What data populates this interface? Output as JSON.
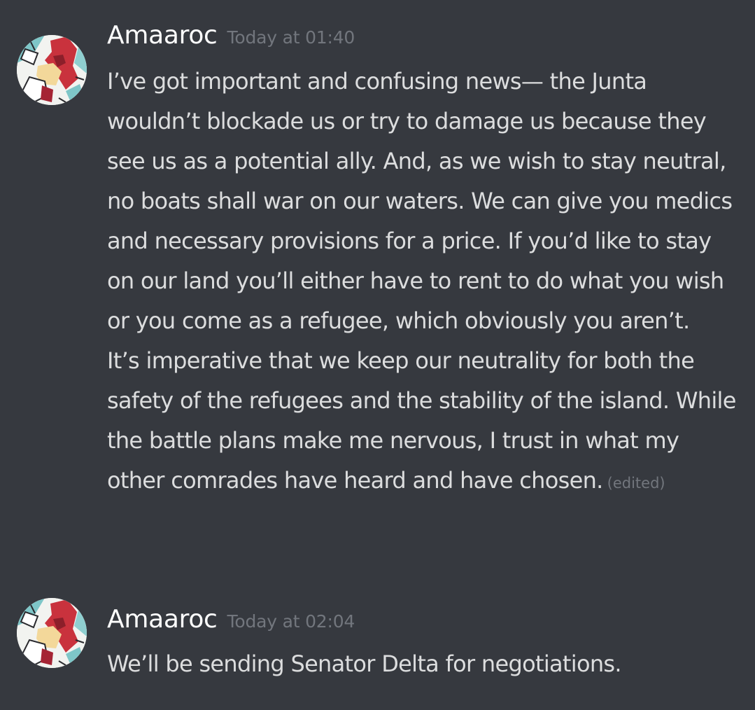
{
  "messages": [
    {
      "author": "Amaaroc",
      "timestamp": "Today at 01:40",
      "avatar_icon": "user-avatar-red-white-character",
      "paragraphs": [
        "I’ve got important and confusing news— the Junta wouldn’t blockade us or try to damage us because they see us as a potential ally. And, as we wish to stay neutral, no boats shall war on our waters. We can give you medics and necessary provisions for a price. If you’d like to stay on our land you’ll either have to rent to do what you wish or you come as a refugee, which obviously you aren’t.",
        "It’s imperative that we keep our neutrality for both the safety of the refugees and the stability of the island. While the battle plans make me nervous, I trust in what my other comrades have heard and have chosen."
      ],
      "edited_label": "(edited)"
    },
    {
      "author": "Amaaroc",
      "timestamp": "Today at 02:04",
      "avatar_icon": "user-avatar-red-white-character",
      "paragraphs": [
        "We’ll be sending Senator Delta for negotiations."
      ]
    }
  ],
  "colors": {
    "background": "#36393f",
    "username": "#ffffff",
    "timestamp": "#72767d",
    "message_text": "#dcddde"
  }
}
